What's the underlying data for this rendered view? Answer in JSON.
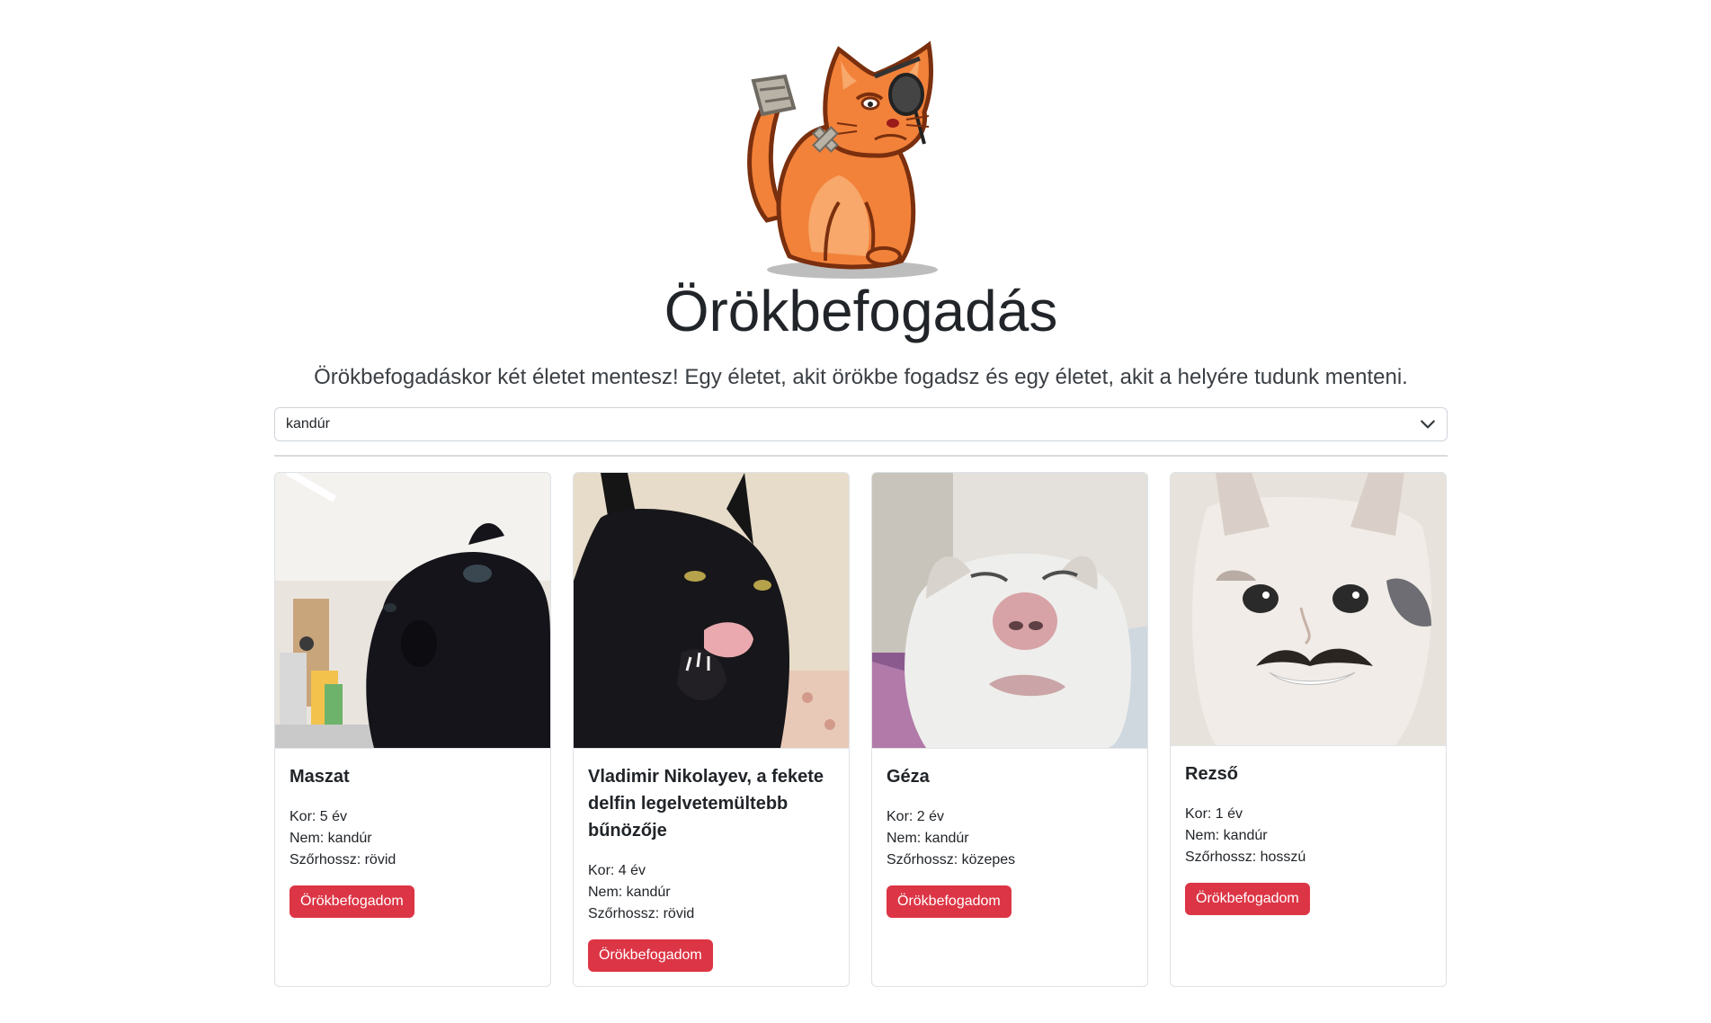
{
  "header": {
    "title": "Örökbefogadás",
    "lead": "Örökbefogadáskor két életet mentesz! Egy életet, akit örökbe fogadsz és egy életet, akit a helyére tudunk menteni."
  },
  "filter": {
    "selected": "kandúr"
  },
  "cats": [
    {
      "name": "Maszat",
      "age": "Kor: 5 év",
      "sex": "Nem: kandúr",
      "fur": "Szőrhossz: rövid",
      "button": "Örökbefogadom"
    },
    {
      "name": "Vladimir Nikolayev, a fekete delfin legelvetemültebb bűnözője",
      "age": "Kor: 4 év",
      "sex": "Nem: kandúr",
      "fur": "Szőrhossz: rövid",
      "button": "Örökbefogadom"
    },
    {
      "name": "Géza",
      "age": "Kor: 2 év",
      "sex": "Nem: kandúr",
      "fur": "Szőrhossz: közepes",
      "button": "Örökbefogadom"
    },
    {
      "name": "Rezső",
      "age": "Kor: 1 év",
      "sex": "Nem: kandúr",
      "fur": "Szőrhossz: hosszú",
      "button": "Örökbefogadom"
    }
  ],
  "colors": {
    "button": "#dc3545",
    "logo_orange": "#f2823a"
  },
  "icons": {
    "logo": "grumpy-orange-cat-logo",
    "select": "chevron-down-icon"
  }
}
